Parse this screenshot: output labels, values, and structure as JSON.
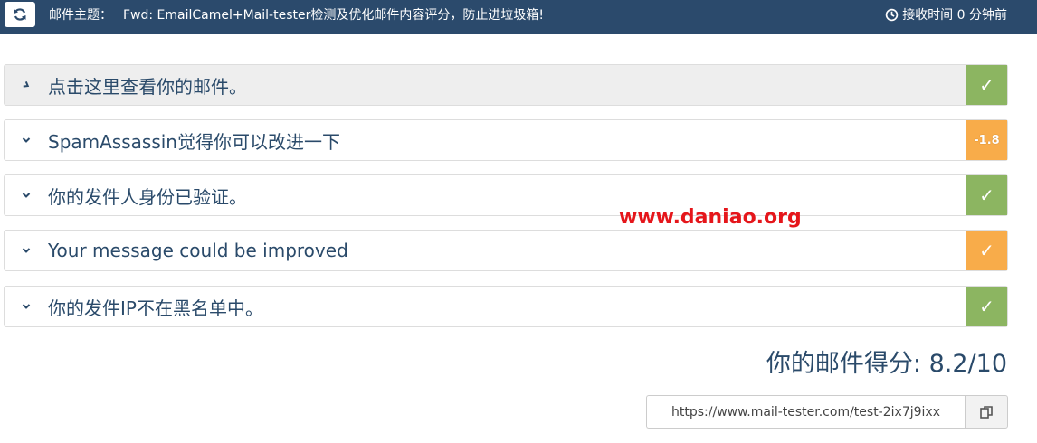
{
  "header": {
    "refresh_icon": "refresh-icon",
    "subject_label": "邮件主题：",
    "subject_text": "Fwd: EmailCamel+Mail-tester检测及优化邮件内容评分，防止进垃圾箱!",
    "received_icon": "clock-icon",
    "received_text": "接收时间 0 分钟前"
  },
  "panels": [
    {
      "title": "点击这里查看你的邮件。",
      "badge": "✓",
      "status": "good",
      "icon": "chevron-right-icon"
    },
    {
      "title": "SpamAssassin觉得你可以改进一下",
      "badge": "-1.8",
      "status": "warning",
      "icon": "chevron-down-icon"
    },
    {
      "title": "你的发件人身份已验证。",
      "badge": "✓",
      "status": "good",
      "icon": "chevron-down-icon"
    },
    {
      "title": "Your message could be improved",
      "badge": "✓",
      "status": "warning",
      "icon": "chevron-down-icon"
    },
    {
      "title": "你的发件IP不在黑名单中。",
      "badge": "✓",
      "status": "good",
      "icon": "chevron-down-icon"
    }
  ],
  "watermark": "www.daniao.org",
  "score": {
    "text": "你的邮件得分: 8.2/10",
    "value": 8.2,
    "max": 10
  },
  "test_url": {
    "value": "https://www.mail-tester.com/test-2ix7j9ixx",
    "copy_icon": "copy-icon"
  },
  "colors": {
    "header_bg": "#2b4a6c",
    "good": "#8cb561",
    "warning": "#f8ac4a",
    "text": "#2a4a6a",
    "watermark": "#e5161b"
  }
}
